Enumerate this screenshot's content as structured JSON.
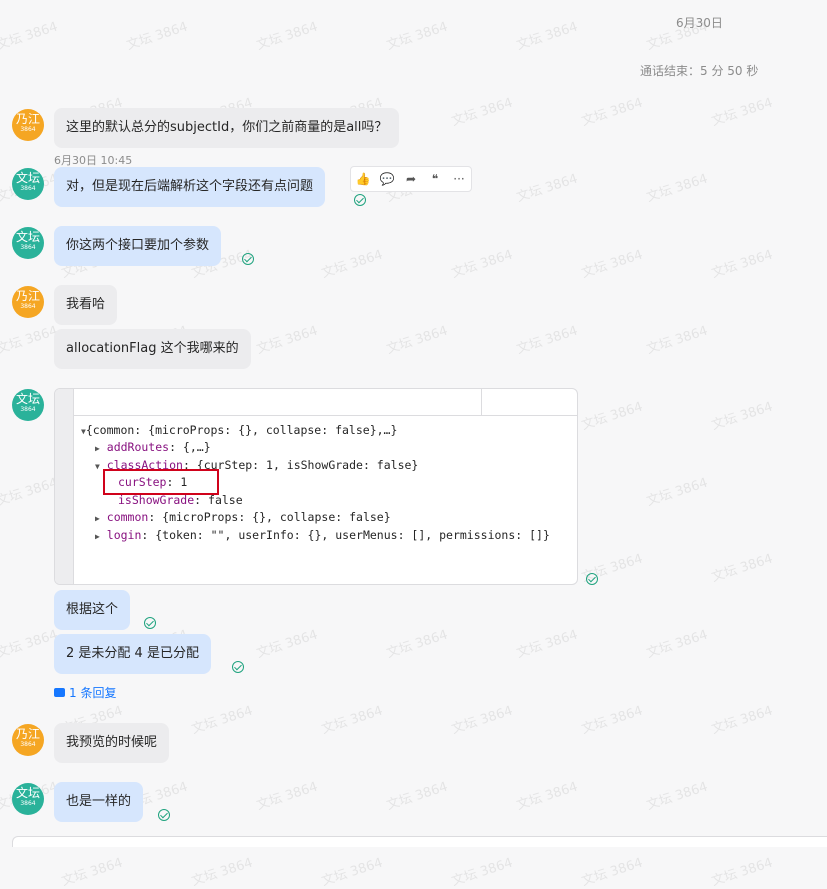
{
  "header": {
    "date": "6月30日",
    "call_ended": "通话结束：5 分 50 秒"
  },
  "avatars": {
    "naijiang": "乃江",
    "wentan": "文坛",
    "sub": "3864"
  },
  "messages": [
    {
      "text": "这里的默认总分的subjectId，你们之前商量的是all吗？"
    },
    {
      "timestamp": "6月30日 10:45",
      "text": "对，但是现在后端解析这个字段还有点问题"
    },
    {
      "text": "你这两个接口要加个参数"
    },
    {
      "text": "我看哈"
    },
    {
      "text": "allocationFlag 这个我哪来的"
    },
    {
      "text": "根据这个"
    },
    {
      "text": "2 是未分配  4 是已分配"
    },
    {
      "text": "我预览的时候呢"
    },
    {
      "text": "也是一样的"
    }
  ],
  "reply_link": "1 条回复",
  "toolbar": {
    "icons": [
      "thumbs-up-icon",
      "comment-icon",
      "forward-icon",
      "quote-icon",
      "more-icon"
    ]
  },
  "code": {
    "line1": "{common: {microProps: {}, collapse: false},…}",
    "line2_key": "addRoutes",
    "line2_val": ": {,…}",
    "line3_key": "classAction",
    "line3_val": ": {curStep: 1, isShowGrade: false}",
    "line4_key": "curStep",
    "line4_val": ": 1",
    "line5_key": "isShowGrade",
    "line5_val": ": false",
    "line6_key": "common",
    "line6_val": ": {microProps: {}, collapse: false}",
    "line7_key": "login",
    "line7_val": ": {token: \"\", userInfo: {}, userMenus: [], permissions: []}"
  },
  "watermark": "文坛 3864",
  "colors": {
    "blue_bubble": "#d6e6fd",
    "gray_bubble": "#ececee",
    "check": "#20a37f",
    "highlight": "#d0021b",
    "link": "#1677ff"
  }
}
